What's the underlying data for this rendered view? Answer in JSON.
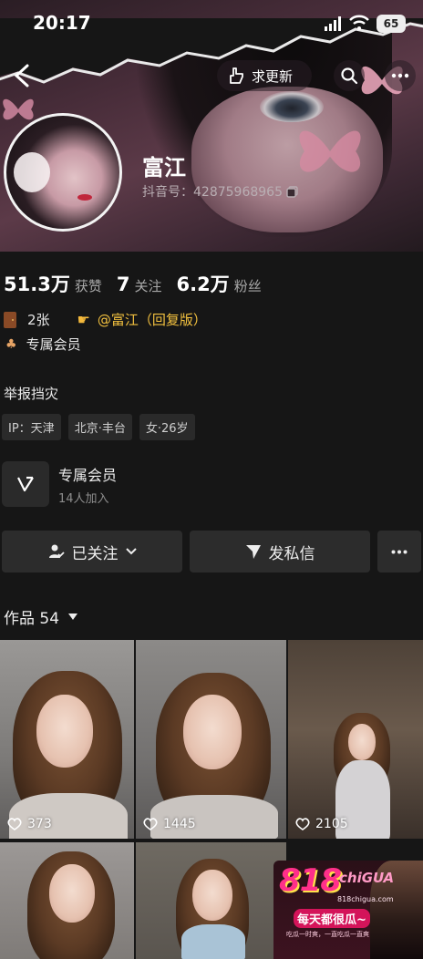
{
  "status_bar": {
    "time": "20:17",
    "battery": "65"
  },
  "nav": {
    "update_label": "求更新"
  },
  "profile": {
    "name": "富江",
    "douyin_id": "抖音号：42875968965"
  },
  "stats": [
    {
      "value": "51.3万",
      "label": "获赞"
    },
    {
      "value": "7",
      "label": "关注"
    },
    {
      "value": "6.2万",
      "label": "粉丝"
    }
  ],
  "info": {
    "count_text": "2张",
    "mention": "@富江（回复版）",
    "member_text": "专属会员"
  },
  "bio": "举报挡灾",
  "tags": [
    "IP：天津",
    "北京·丰台",
    "女·26岁"
  ],
  "member_card": {
    "title": "专属会员",
    "subtitle": "14人加入"
  },
  "actions": {
    "follow_label": "已关注",
    "message_label": "发私信"
  },
  "works": {
    "title": "作品 54",
    "items": [
      {
        "likes": "373"
      },
      {
        "likes": "1445"
      },
      {
        "likes": "2105"
      }
    ]
  },
  "ad": {
    "logo": "818",
    "logo_text": "chiGUA",
    "site": "818chigua.com",
    "slogan": "每天都很瓜~",
    "sub": "吃瓜一时爽，一直吃瓜一直爽"
  },
  "colors": {
    "background": "#161616",
    "mention": "#f3c13f",
    "button_bg": "#2c2c2c"
  }
}
